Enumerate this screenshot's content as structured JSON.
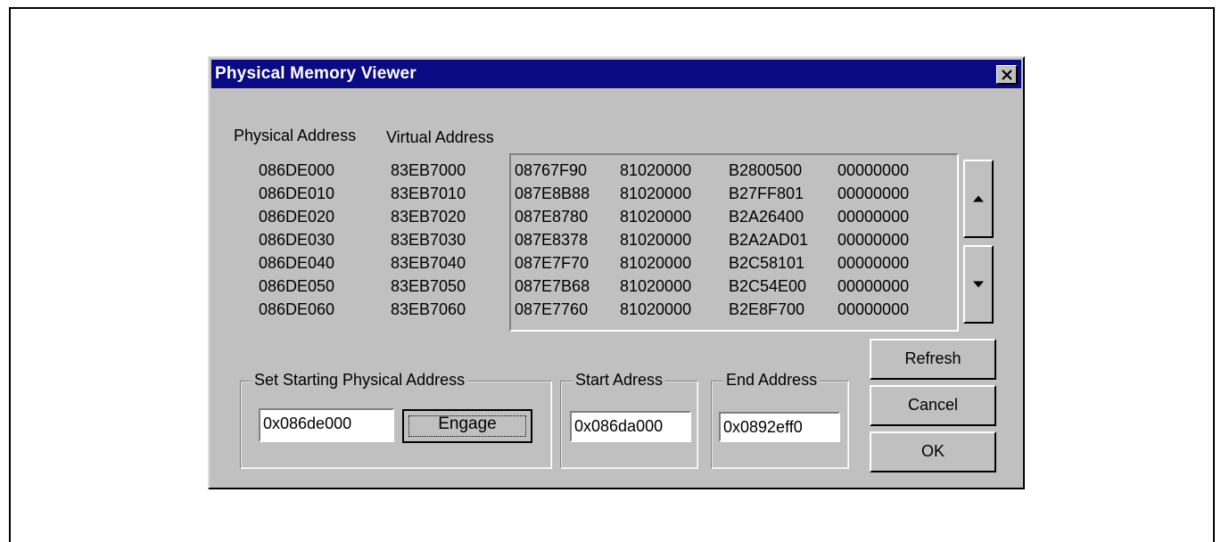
{
  "dialog": {
    "title": "Physical Memory Viewer",
    "close_label": "✕"
  },
  "headers": {
    "physical": "Physical Address",
    "virtual": "Virtual Address"
  },
  "physical_addresses": [
    "086DE000",
    "086DE010",
    "086DE020",
    "086DE030",
    "086DE040",
    "086DE050",
    "086DE060"
  ],
  "virtual_addresses": [
    "83EB7000",
    "83EB7010",
    "83EB7020",
    "83EB7030",
    "83EB7040",
    "83EB7050",
    "83EB7060"
  ],
  "memory_rows": [
    [
      "08767F90",
      "81020000",
      "B2800500",
      "00000000"
    ],
    [
      "087E8B88",
      "81020000",
      "B27FF801",
      "00000000"
    ],
    [
      "087E8780",
      "81020000",
      "B2A26400",
      "00000000"
    ],
    [
      "087E8378",
      "81020000",
      "B2A2AD01",
      "00000000"
    ],
    [
      "087E7F70",
      "81020000",
      "B2C58101",
      "00000000"
    ],
    [
      "087E7B68",
      "81020000",
      "B2C54E00",
      "00000000"
    ],
    [
      "087E7760",
      "81020000",
      "B2E8F700",
      "00000000"
    ]
  ],
  "scroll": {
    "up_icon": "arrow-up",
    "down_icon": "arrow-down"
  },
  "set_start": {
    "label": "Set Starting Physical Address",
    "value": "0x086de000",
    "engage_label": "Engage"
  },
  "start_address": {
    "label": "Start Adress",
    "value": "0x086da000"
  },
  "end_address": {
    "label": "End Address",
    "value": "0x0892eff0"
  },
  "buttons": {
    "refresh": "Refresh",
    "cancel": "Cancel",
    "ok": "OK"
  }
}
